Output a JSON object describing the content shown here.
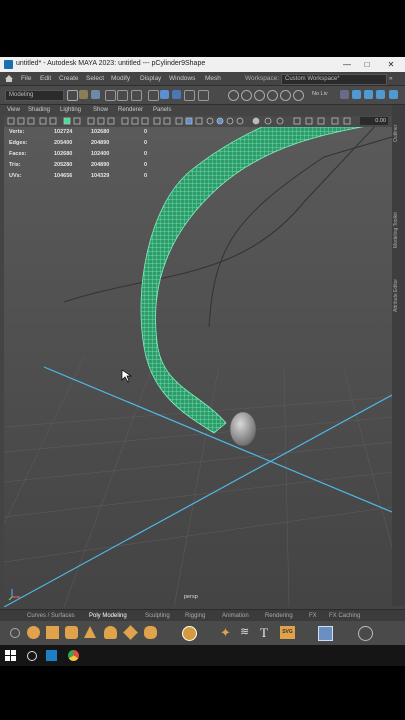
{
  "window": {
    "title": "untitled* - Autodesk MAYA 2023: untitled   ---   pCylinder9Shape",
    "minimize": "—",
    "maximize": "□",
    "close": "✕"
  },
  "menubar": {
    "items": [
      "File",
      "Edit",
      "Create",
      "Select",
      "Modify",
      "Display",
      "Windows",
      "Mesh"
    ],
    "workspace_label": "Workspace:",
    "workspace_value": "Custom Workspace*"
  },
  "toolbar": {
    "menuset": "Modeling",
    "nolive": "No Liv",
    "icons": [
      "new-scene-icon",
      "open-scene-icon",
      "save-scene-icon",
      "undo-icon",
      "redo-icon",
      "select-tool-icon",
      "lasso-icon",
      "paint-select-icon",
      "snap-grid-icon",
      "snap-curve-icon",
      "snap-point-icon",
      "snap-view-icon",
      "snap-surface-icon",
      "history-icon",
      "render-icon",
      "ipr-icon",
      "render-settings-icon",
      "hypershade-icon"
    ]
  },
  "panel": {
    "menus": [
      "View",
      "Shading",
      "Lighting",
      "Show",
      "Renderer",
      "Panels"
    ],
    "exposure": "0.00"
  },
  "hud": {
    "rows": [
      {
        "label": "Verts:",
        "a": "102724",
        "b": "102680",
        "c": "0"
      },
      {
        "label": "Edges:",
        "a": "205400",
        "b": "204890",
        "c": "0"
      },
      {
        "label": "Faces:",
        "a": "102680",
        "b": "102400",
        "c": "0"
      },
      {
        "label": "Tris:",
        "a": "205280",
        "b": "204890",
        "c": "0"
      },
      {
        "label": "UVs:",
        "a": "104656",
        "b": "104329",
        "c": "0"
      }
    ]
  },
  "viewport": {
    "camera": "persp",
    "wire_color": "#39e29a",
    "grid_axis_color": "#4fb7e6"
  },
  "dock_tabs": [
    "Outliner",
    "Modeling Toolkit",
    "Attribute Editor"
  ],
  "shelf": {
    "tabs": [
      "Curves / Surfaces",
      "Poly Modeling",
      "Sculpting",
      "Rigging",
      "Animation",
      "Rendering",
      "FX",
      "FX Caching"
    ],
    "active": "Poly Modeling",
    "svg_label": "SVG",
    "text_tool": "T"
  },
  "taskbar": {
    "icons": [
      "windows-start-icon",
      "search-icon",
      "maya-app-icon",
      "chrome-icon"
    ]
  }
}
